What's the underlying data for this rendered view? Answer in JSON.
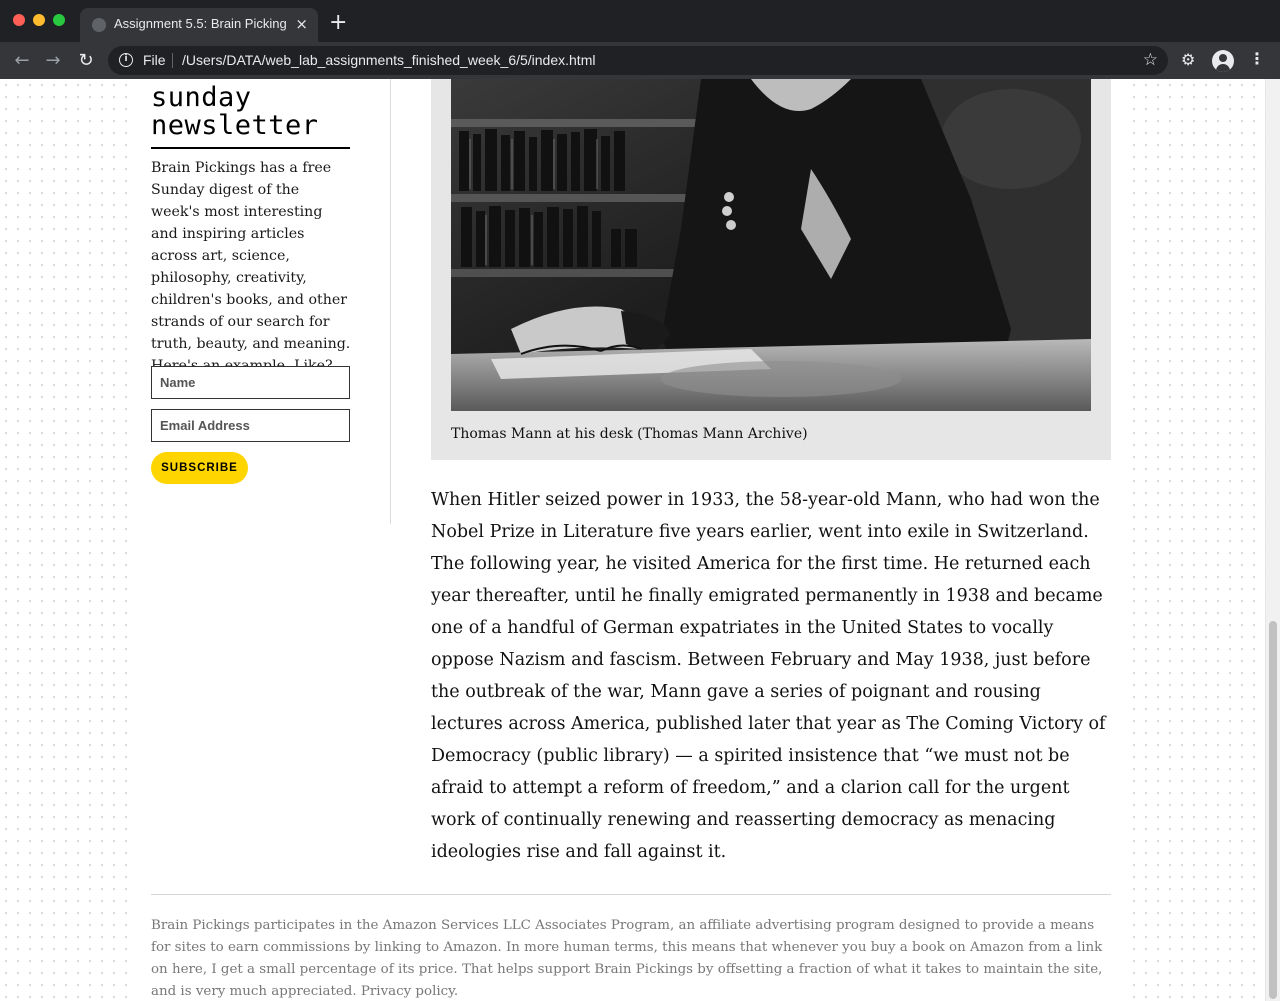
{
  "browser": {
    "tab_title": "Assignment 5.5: Brain Pickings",
    "tab_close": "×",
    "new_tab": "+",
    "url_scheme": "File",
    "url": "/Users/DATA/web_lab_assignments_finished_week_6/5/index.html",
    "icons": [
      "favicon-icon",
      "back-icon",
      "forward-icon",
      "reload-icon",
      "info-icon",
      "star-icon",
      "extensions-icon",
      "profile-icon",
      "menu-icon"
    ],
    "colors": {
      "tabbar": "#202124",
      "toolbar": "#35363a"
    }
  },
  "sidebar": {
    "heading": "sunday newsletter",
    "description": "Brain Pickings has a free Sunday digest of the week's most interesting and inspiring articles across art, science, philosophy, creativity, children's books, and other strands of our search for truth, beauty, and meaning. Here's an example. Like? Claim yours:",
    "name_placeholder": "Name",
    "email_placeholder": "Email Address",
    "subscribe_label": "SUBSCRIBE",
    "subscribe_color": "#ffd500"
  },
  "article": {
    "caption": "Thomas Mann at his desk (Thomas Mann Archive)",
    "paragraph": "When Hitler seized power in 1933, the 58-year-old Mann, who had won the Nobel Prize in Literature five years earlier, went into exile in Switzerland. The following year, he visited America for the first time. He returned each year thereafter, until he finally emigrated permanently in 1938 and became one of a handful of German expatriates in the United States to vocally oppose Nazism and fascism. Between February and May 1938, just before the outbreak of the war, Mann gave a series of poignant and rousing lectures across America, published later that year as The Coming Victory of Democracy (public library) — a spirited insistence that “we must not be afraid to attempt a reform of freedom,” and a clarion call for the urgent work of continually renewing and reasserting democracy as menacing ideologies rise and fall against it."
  },
  "footer": {
    "disclosure": "Brain Pickings participates in the Amazon Services LLC Associates Program, an affiliate advertising program designed to provide a means for sites to earn commissions by linking to Amazon. In more human terms, this means that whenever you buy a book on Amazon from a link on here, I get a small percentage of its price. That helps support Brain Pickings by offsetting a fraction of what it takes to maintain the site, and is very much appreciated. Privacy policy."
  }
}
